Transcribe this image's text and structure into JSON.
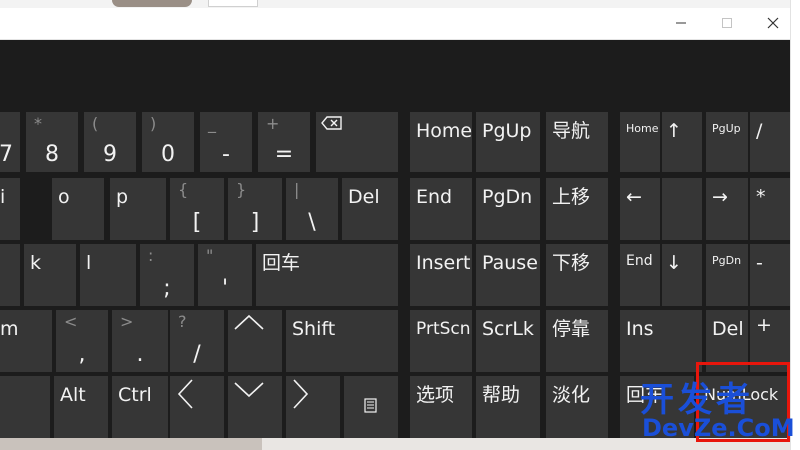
{
  "window": {
    "minimize_icon": "minimize-icon",
    "maximize_icon": "maximize-icon",
    "close_icon": "close-icon"
  },
  "main_keys": {
    "row1": {
      "k7": "7",
      "k8": "8",
      "k8_shift": "*",
      "k9": "9",
      "k9_shift": "(",
      "k0": "0",
      "k0_shift": ")",
      "minus": "-",
      "minus_shift": "_",
      "equals": "=",
      "equals_shift": "+",
      "backspace_icon": "backspace-icon"
    },
    "row2": {
      "i": "i",
      "o": "o",
      "p": "p",
      "lbracket": "[",
      "lbracket_shift": "{",
      "rbracket": "]",
      "rbracket_shift": "}",
      "backslash": "\\",
      "backslash_shift": "|",
      "del": "Del"
    },
    "row3": {
      "k": "k",
      "l": "l",
      "semicolon": ";",
      "semicolon_shift": ":",
      "quote": "'",
      "quote_shift": "\"",
      "enter": "回车"
    },
    "row4": {
      "m": "m",
      "comma": ",",
      "comma_shift": "<",
      "period": ".",
      "period_shift": ">",
      "slash": "/",
      "slash_shift": "?",
      "up": "^",
      "shift": "Shift"
    },
    "row5": {
      "alt": "Alt",
      "ctrl": "Ctrl",
      "left": "<",
      "down": "v",
      "right": ">",
      "menu_icon": "menu-icon"
    }
  },
  "nav_keys": {
    "home": "Home",
    "pgup": "PgUp",
    "nav": "导航",
    "end": "End",
    "pgdn": "PgDn",
    "moveup": "上移",
    "insert": "Insert",
    "pause": "Pause",
    "movedown": "下移",
    "prtscn": "PrtScn",
    "scrlk": "ScrLk",
    "dock": "停靠",
    "options": "选项",
    "help": "帮助",
    "fade": "淡化"
  },
  "numpad": {
    "home": "Home",
    "up": "↑",
    "pgup": "PgUp",
    "divide": "/",
    "left": "←",
    "right": "→",
    "multiply": "*",
    "end": "End",
    "down": "↓",
    "pgdn": "PgDn",
    "minus": "-",
    "ins": "Ins",
    "del": "Del",
    "plus": "+",
    "enter": "回车",
    "numlock": "NumLock"
  },
  "watermark": {
    "cn": "开发者",
    "en": "DevZe.CoM"
  },
  "colors": {
    "keyboard_bg": "#1c1c1c",
    "key_bg": "#363636",
    "key_text": "#f2f2f2",
    "shift_text": "#8c8c8c",
    "watermark_blue": "#1a4fd8",
    "highlight_red": "#e8160c"
  }
}
